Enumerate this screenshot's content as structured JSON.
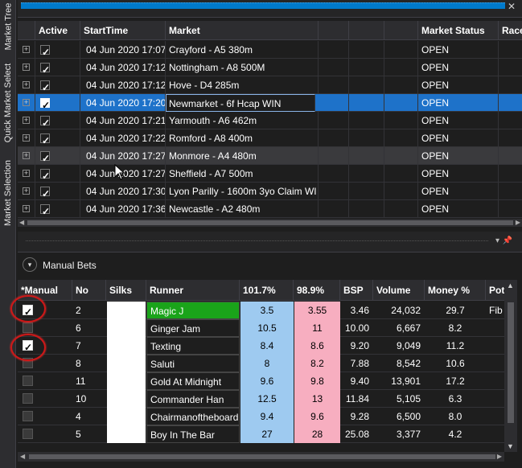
{
  "side_tabs": [
    "Market Tree",
    "Quick Market Select",
    "Market Selection"
  ],
  "market_grid": {
    "columns": [
      "Active",
      "StartTime",
      "Market",
      "Market Status",
      "Race"
    ],
    "rows": [
      {
        "active": true,
        "start": "04 Jun 2020 17:07",
        "market": "Crayford - A5 380m",
        "flag": "uk",
        "yellow_flag": false,
        "status": "OPEN"
      },
      {
        "active": true,
        "start": "04 Jun 2020 17:12",
        "market": "Nottingham - A8 500M",
        "flag": "uk",
        "yellow_flag": false,
        "status": "OPEN"
      },
      {
        "active": true,
        "start": "04 Jun 2020 17:12",
        "market": "Hove - D4 285m",
        "flag": "uk",
        "yellow_flag": false,
        "status": "OPEN"
      },
      {
        "active": true,
        "start": "04 Jun 2020 17:20",
        "market": "Newmarket - 6f Hcap WIN",
        "flag": "uk",
        "yellow_flag": true,
        "status": "OPEN"
      },
      {
        "active": true,
        "start": "04 Jun 2020 17:21",
        "market": "Yarmouth - A6 462m",
        "flag": "uk",
        "yellow_flag": false,
        "status": "OPEN"
      },
      {
        "active": true,
        "start": "04 Jun 2020 17:22",
        "market": "Romford - A8 400m",
        "flag": "uk",
        "yellow_flag": false,
        "status": "OPEN"
      },
      {
        "active": true,
        "start": "04 Jun 2020 17:27",
        "market": "Monmore - A4 480m",
        "flag": "uk",
        "yellow_flag": false,
        "status": "OPEN"
      },
      {
        "active": true,
        "start": "04 Jun 2020 17:27",
        "market": "Sheffield - A7 500m",
        "flag": "uk",
        "yellow_flag": false,
        "status": "OPEN"
      },
      {
        "active": true,
        "start": "04 Jun 2020 17:30",
        "market": "Lyon Parilly - 1600m 3yo Claim WI",
        "flag": "fr",
        "yellow_flag": true,
        "status": "OPEN"
      },
      {
        "active": true,
        "start": "04 Jun 2020 17:36",
        "market": "Newcastle - A2 480m",
        "flag": "uk",
        "yellow_flag": false,
        "status": "OPEN"
      }
    ]
  },
  "manual_bets": {
    "title": "Manual Bets",
    "columns": [
      "*Manual",
      "No",
      "Silks",
      "Runner",
      "101.7%",
      "98.9%",
      "BSP",
      "Volume",
      "Money %",
      "Pot"
    ],
    "rows": [
      {
        "manual": true,
        "no": "2",
        "runner": "Magic J",
        "back": "3.5",
        "lay": "3.55",
        "bsp": "3.46",
        "volume": "24,032",
        "money": "29.7",
        "pot": "Fib",
        "silk": [
          "#ffffff",
          "#d22020"
        ]
      },
      {
        "manual": false,
        "no": "6",
        "runner": "Ginger Jam",
        "back": "10.5",
        "lay": "11",
        "bsp": "10.00",
        "volume": "6,667",
        "money": "8.2",
        "pot": "",
        "silk": [
          "#111111",
          "#e08a20"
        ]
      },
      {
        "manual": true,
        "no": "7",
        "runner": "Texting",
        "back": "8.4",
        "lay": "8.6",
        "bsp": "9.20",
        "volume": "9,049",
        "money": "11.2",
        "pot": "",
        "silk": [
          "#1c9a3a",
          "#d22020"
        ]
      },
      {
        "manual": false,
        "no": "8",
        "runner": "Saluti",
        "back": "8",
        "lay": "8.2",
        "bsp": "7.88",
        "volume": "8,542",
        "money": "10.6",
        "pot": "",
        "silk": [
          "#1c9a3a",
          "#ffffff"
        ]
      },
      {
        "manual": false,
        "no": "11",
        "runner": "Gold At Midnight",
        "back": "9.6",
        "lay": "9.8",
        "bsp": "9.40",
        "volume": "13,901",
        "money": "17.2",
        "pot": "",
        "silk": [
          "#1a3a9a",
          "#e8d020"
        ]
      },
      {
        "manual": false,
        "no": "10",
        "runner": "Commander Han",
        "back": "12.5",
        "lay": "13",
        "bsp": "11.84",
        "volume": "5,105",
        "money": "6.3",
        "pot": "",
        "silk": [
          "#1a7a3a",
          "#e8d020"
        ]
      },
      {
        "manual": false,
        "no": "4",
        "runner": "Chairmanoftheboard",
        "back": "9.4",
        "lay": "9.6",
        "bsp": "9.28",
        "volume": "6,500",
        "money": "8.0",
        "pot": "",
        "silk": [
          "#e8d020",
          "#1a3a9a"
        ]
      },
      {
        "manual": false,
        "no": "5",
        "runner": "Boy In The Bar",
        "back": "27",
        "lay": "28",
        "bsp": "25.08",
        "volume": "3,377",
        "money": "4.2",
        "pot": "",
        "silk": [
          "#6a2aa0",
          "#ffffff"
        ]
      }
    ]
  },
  "colors": {
    "accent": "#007acc",
    "selected_row": "#1e72c9",
    "back": "#9ecaf0",
    "lay": "#f7aec0",
    "winner": "#1aa41a",
    "highlight_circle": "#d01818"
  }
}
